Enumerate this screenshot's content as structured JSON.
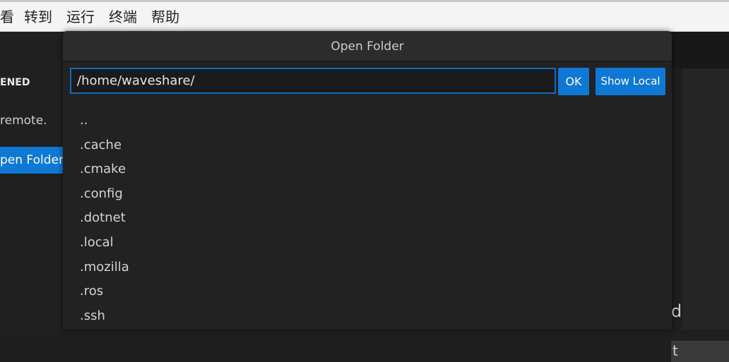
{
  "menubar": {
    "items": [
      "看",
      "转到",
      "运行",
      "终端",
      "帮助"
    ]
  },
  "sidebar": {
    "heading": "ENED",
    "message": "remote.",
    "open_folder_label": "pen Folder"
  },
  "dialog": {
    "title": "Open Folder",
    "path_value": "/home/waveshare/",
    "ok_label": "OK",
    "show_local_label": "Show Local",
    "entries": [
      "..",
      ".cache",
      ".cmake",
      ".config",
      ".dotnet",
      ".local",
      ".mozilla",
      ".ros",
      ".ssh"
    ]
  },
  "editor": {
    "fragment_1": "d",
    "fragment_2": "t"
  },
  "colors": {
    "accent": "#0e78d4",
    "dialog_bg": "#222222",
    "menubar_bg": "#f4f4f4"
  }
}
